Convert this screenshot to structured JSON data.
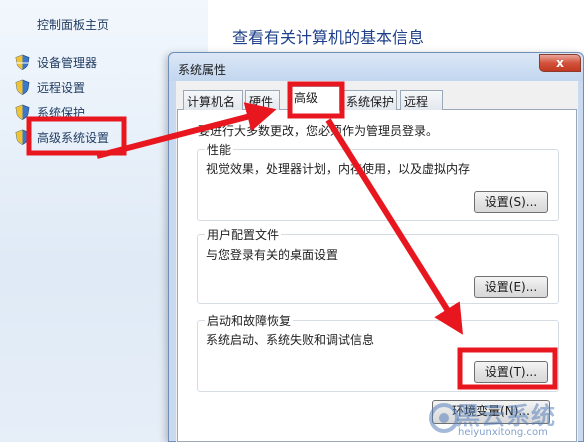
{
  "sidebar": {
    "title": "控制面板主页",
    "items": [
      {
        "label": "设备管理器"
      },
      {
        "label": "远程设置"
      },
      {
        "label": "系统保护"
      },
      {
        "label": "高级系统设置"
      }
    ]
  },
  "main": {
    "heading": "查看有关计算机的基本信息"
  },
  "dialog": {
    "title": "系统属性",
    "close_label": "x",
    "tabs": [
      {
        "label": "计算机名"
      },
      {
        "label": "硬件"
      },
      {
        "label": "高级"
      },
      {
        "label": "系统保护"
      },
      {
        "label": "远程"
      }
    ],
    "active_tab": "高级",
    "admin_note": "要进行大多数更改，您必须作为管理员登录。",
    "groups": {
      "performance": {
        "title": "性能",
        "description": "视觉效果，处理器计划，内存使用，以及虚拟内存",
        "button": "设置(S)..."
      },
      "user_profiles": {
        "title": "用户配置文件",
        "description": "与您登录有关的桌面设置",
        "button": "设置(E)..."
      },
      "startup_recovery": {
        "title": "启动和故障恢复",
        "description": "系统启动、系统失败和调试信息",
        "button": "设置(T)..."
      }
    },
    "env_button": "环境变量(N)..."
  },
  "watermark": {
    "text": "黑云系统",
    "url": "heiyunxitong.com"
  },
  "colors": {
    "annotation_red": "#e8171f",
    "heading_blue": "#1e3f8a",
    "dialog_frame": "#c9daf0",
    "close_red": "#c1391f"
  }
}
